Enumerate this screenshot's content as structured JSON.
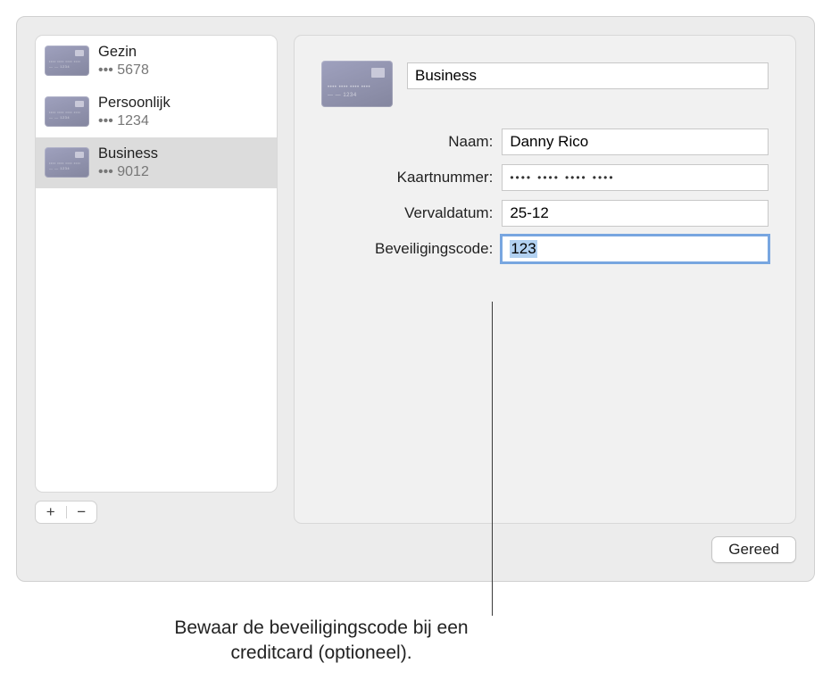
{
  "sidebar": {
    "cards": [
      {
        "title": "Gezin",
        "sub": "••• 5678"
      },
      {
        "title": "Persoonlijk",
        "sub": "••• 1234"
      },
      {
        "title": "Business",
        "sub": "••• 9012"
      }
    ],
    "selected_index": 2,
    "add_label": "+",
    "remove_label": "−"
  },
  "detail": {
    "card_name": "Business",
    "fields": {
      "name": {
        "label": "Naam:",
        "value": "Danny Rico"
      },
      "number": {
        "label": "Kaartnummer:",
        "value": "•••• •••• •••• ••••"
      },
      "expiry": {
        "label": "Vervaldatum:",
        "value": "25-12"
      },
      "security": {
        "label": "Beveiligingscode:",
        "value": "123"
      }
    }
  },
  "footer": {
    "done_label": "Gereed"
  },
  "callout": {
    "text": "Bewaar de beveiligingscode bij een creditcard (optioneel)."
  }
}
